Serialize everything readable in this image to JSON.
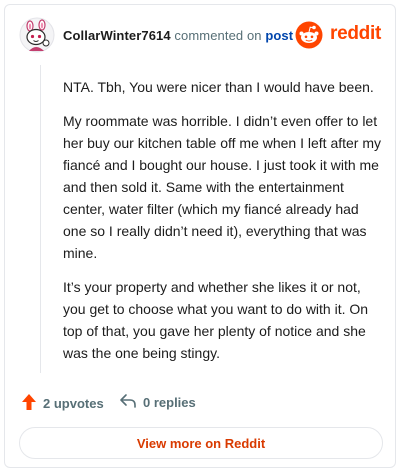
{
  "header": {
    "username": "CollarWinter7614",
    "action_text": "commented on",
    "post_link": "post"
  },
  "brand": {
    "wordmark": "reddit",
    "icon": "reddit-logo-icon",
    "color": "#ff4500"
  },
  "avatar": {
    "icon": "snoo-avatar-icon"
  },
  "comment": {
    "paragraphs": [
      "NTA. Tbh, You were nicer than I would have been.",
      "My roommate was horrible. I didn’t even offer to let her buy our kitchen table off me when I left after my fiancé and I bought our house. I just took it with me and then sold it. Same with the entertainment center, water filter (which my fiancé already had one so I really didn’t need it), everything that was mine.",
      "It’s your property and whether she likes it or not, you get to choose what you want to do with it. On top of that, you gave her plenty of notice and she was the one being stingy."
    ]
  },
  "actions": {
    "upvotes_label": "2 upvotes",
    "replies_label": "0 replies",
    "upvote_icon": "upvote-arrow-icon",
    "reply_icon": "reply-arrow-icon"
  },
  "footer": {
    "view_more_label": "View more on Reddit"
  },
  "colors": {
    "accent": "#ff4500",
    "link": "#0045ac",
    "muted": "#576f76",
    "button_text": "#d93a00"
  }
}
